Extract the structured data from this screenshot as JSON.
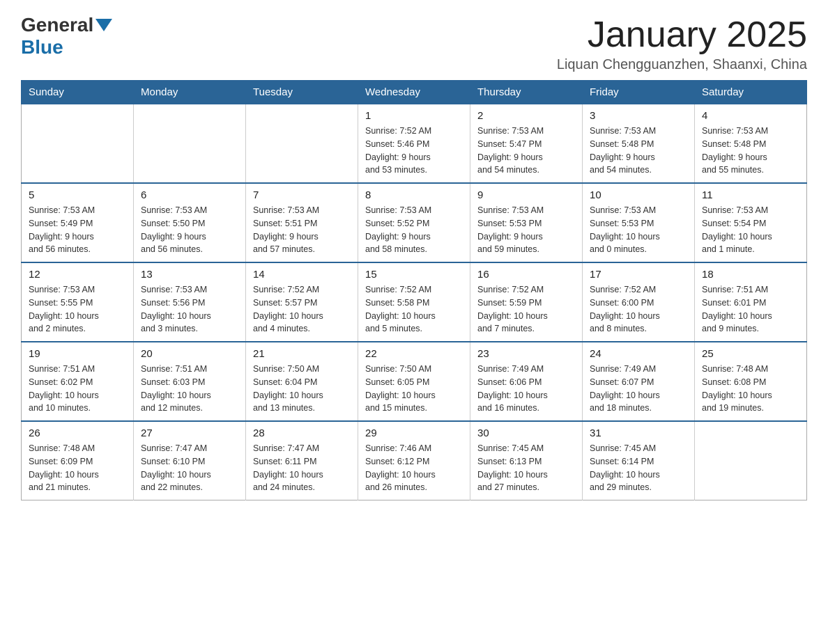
{
  "header": {
    "logo_general": "General",
    "logo_blue": "Blue",
    "month_title": "January 2025",
    "location": "Liquan Chengguanzhen, Shaanxi, China"
  },
  "days_of_week": [
    "Sunday",
    "Monday",
    "Tuesday",
    "Wednesday",
    "Thursday",
    "Friday",
    "Saturday"
  ],
  "weeks": [
    [
      {
        "day": "",
        "info": ""
      },
      {
        "day": "",
        "info": ""
      },
      {
        "day": "",
        "info": ""
      },
      {
        "day": "1",
        "info": "Sunrise: 7:52 AM\nSunset: 5:46 PM\nDaylight: 9 hours\nand 53 minutes."
      },
      {
        "day": "2",
        "info": "Sunrise: 7:53 AM\nSunset: 5:47 PM\nDaylight: 9 hours\nand 54 minutes."
      },
      {
        "day": "3",
        "info": "Sunrise: 7:53 AM\nSunset: 5:48 PM\nDaylight: 9 hours\nand 54 minutes."
      },
      {
        "day": "4",
        "info": "Sunrise: 7:53 AM\nSunset: 5:48 PM\nDaylight: 9 hours\nand 55 minutes."
      }
    ],
    [
      {
        "day": "5",
        "info": "Sunrise: 7:53 AM\nSunset: 5:49 PM\nDaylight: 9 hours\nand 56 minutes."
      },
      {
        "day": "6",
        "info": "Sunrise: 7:53 AM\nSunset: 5:50 PM\nDaylight: 9 hours\nand 56 minutes."
      },
      {
        "day": "7",
        "info": "Sunrise: 7:53 AM\nSunset: 5:51 PM\nDaylight: 9 hours\nand 57 minutes."
      },
      {
        "day": "8",
        "info": "Sunrise: 7:53 AM\nSunset: 5:52 PM\nDaylight: 9 hours\nand 58 minutes."
      },
      {
        "day": "9",
        "info": "Sunrise: 7:53 AM\nSunset: 5:53 PM\nDaylight: 9 hours\nand 59 minutes."
      },
      {
        "day": "10",
        "info": "Sunrise: 7:53 AM\nSunset: 5:53 PM\nDaylight: 10 hours\nand 0 minutes."
      },
      {
        "day": "11",
        "info": "Sunrise: 7:53 AM\nSunset: 5:54 PM\nDaylight: 10 hours\nand 1 minute."
      }
    ],
    [
      {
        "day": "12",
        "info": "Sunrise: 7:53 AM\nSunset: 5:55 PM\nDaylight: 10 hours\nand 2 minutes."
      },
      {
        "day": "13",
        "info": "Sunrise: 7:53 AM\nSunset: 5:56 PM\nDaylight: 10 hours\nand 3 minutes."
      },
      {
        "day": "14",
        "info": "Sunrise: 7:52 AM\nSunset: 5:57 PM\nDaylight: 10 hours\nand 4 minutes."
      },
      {
        "day": "15",
        "info": "Sunrise: 7:52 AM\nSunset: 5:58 PM\nDaylight: 10 hours\nand 5 minutes."
      },
      {
        "day": "16",
        "info": "Sunrise: 7:52 AM\nSunset: 5:59 PM\nDaylight: 10 hours\nand 7 minutes."
      },
      {
        "day": "17",
        "info": "Sunrise: 7:52 AM\nSunset: 6:00 PM\nDaylight: 10 hours\nand 8 minutes."
      },
      {
        "day": "18",
        "info": "Sunrise: 7:51 AM\nSunset: 6:01 PM\nDaylight: 10 hours\nand 9 minutes."
      }
    ],
    [
      {
        "day": "19",
        "info": "Sunrise: 7:51 AM\nSunset: 6:02 PM\nDaylight: 10 hours\nand 10 minutes."
      },
      {
        "day": "20",
        "info": "Sunrise: 7:51 AM\nSunset: 6:03 PM\nDaylight: 10 hours\nand 12 minutes."
      },
      {
        "day": "21",
        "info": "Sunrise: 7:50 AM\nSunset: 6:04 PM\nDaylight: 10 hours\nand 13 minutes."
      },
      {
        "day": "22",
        "info": "Sunrise: 7:50 AM\nSunset: 6:05 PM\nDaylight: 10 hours\nand 15 minutes."
      },
      {
        "day": "23",
        "info": "Sunrise: 7:49 AM\nSunset: 6:06 PM\nDaylight: 10 hours\nand 16 minutes."
      },
      {
        "day": "24",
        "info": "Sunrise: 7:49 AM\nSunset: 6:07 PM\nDaylight: 10 hours\nand 18 minutes."
      },
      {
        "day": "25",
        "info": "Sunrise: 7:48 AM\nSunset: 6:08 PM\nDaylight: 10 hours\nand 19 minutes."
      }
    ],
    [
      {
        "day": "26",
        "info": "Sunrise: 7:48 AM\nSunset: 6:09 PM\nDaylight: 10 hours\nand 21 minutes."
      },
      {
        "day": "27",
        "info": "Sunrise: 7:47 AM\nSunset: 6:10 PM\nDaylight: 10 hours\nand 22 minutes."
      },
      {
        "day": "28",
        "info": "Sunrise: 7:47 AM\nSunset: 6:11 PM\nDaylight: 10 hours\nand 24 minutes."
      },
      {
        "day": "29",
        "info": "Sunrise: 7:46 AM\nSunset: 6:12 PM\nDaylight: 10 hours\nand 26 minutes."
      },
      {
        "day": "30",
        "info": "Sunrise: 7:45 AM\nSunset: 6:13 PM\nDaylight: 10 hours\nand 27 minutes."
      },
      {
        "day": "31",
        "info": "Sunrise: 7:45 AM\nSunset: 6:14 PM\nDaylight: 10 hours\nand 29 minutes."
      },
      {
        "day": "",
        "info": ""
      }
    ]
  ]
}
